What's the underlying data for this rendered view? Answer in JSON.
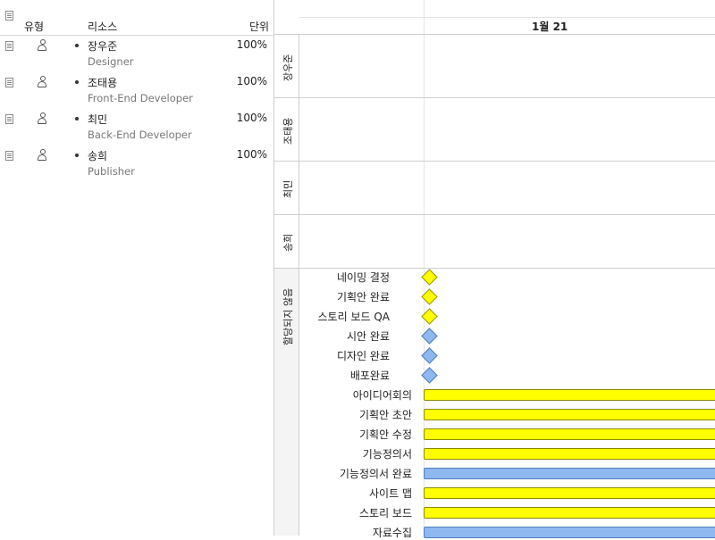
{
  "table": {
    "headers": {
      "type": "유형",
      "resource": "리소스",
      "unit": "단위"
    },
    "rows": [
      {
        "name": "장우준",
        "role": "Designer",
        "unit": "100%"
      },
      {
        "name": "조태용",
        "role": "Front-End Developer",
        "unit": "100%"
      },
      {
        "name": "최민",
        "role": "Back-End Developer",
        "unit": "100%"
      },
      {
        "name": "송희",
        "role": "Publisher",
        "unit": "100%"
      }
    ]
  },
  "gantt": {
    "date_header": "1월 21",
    "lanes": [
      "장우준",
      "조태용",
      "최민",
      "송희"
    ],
    "unassigned_label": "할당되지 않음",
    "milestones": [
      {
        "label": "네이밍 결정",
        "color": "#ffff00"
      },
      {
        "label": "기획안 완료",
        "color": "#ffff00"
      },
      {
        "label": "스토리 보드 QA",
        "color": "#ffff00"
      },
      {
        "label": "시안 완료",
        "color": "#8fb8f0"
      },
      {
        "label": "디자인 완료",
        "color": "#8fb8f0"
      },
      {
        "label": "배포완료",
        "color": "#8fb8f0"
      }
    ],
    "tasks": [
      {
        "label": "아이디어회의",
        "color": "#ffff00"
      },
      {
        "label": "기획안 초안",
        "color": "#ffff00"
      },
      {
        "label": "기획안 수정",
        "color": "#ffff00"
      },
      {
        "label": "기능정의서",
        "color": "#ffff00"
      },
      {
        "label": "기능정의서 완료",
        "color": "#8fb8f0"
      },
      {
        "label": "사이트 맵",
        "color": "#ffff00"
      },
      {
        "label": "스토리 보드",
        "color": "#ffff00"
      },
      {
        "label": "자료수집",
        "color": "#8fb8f0"
      }
    ]
  }
}
